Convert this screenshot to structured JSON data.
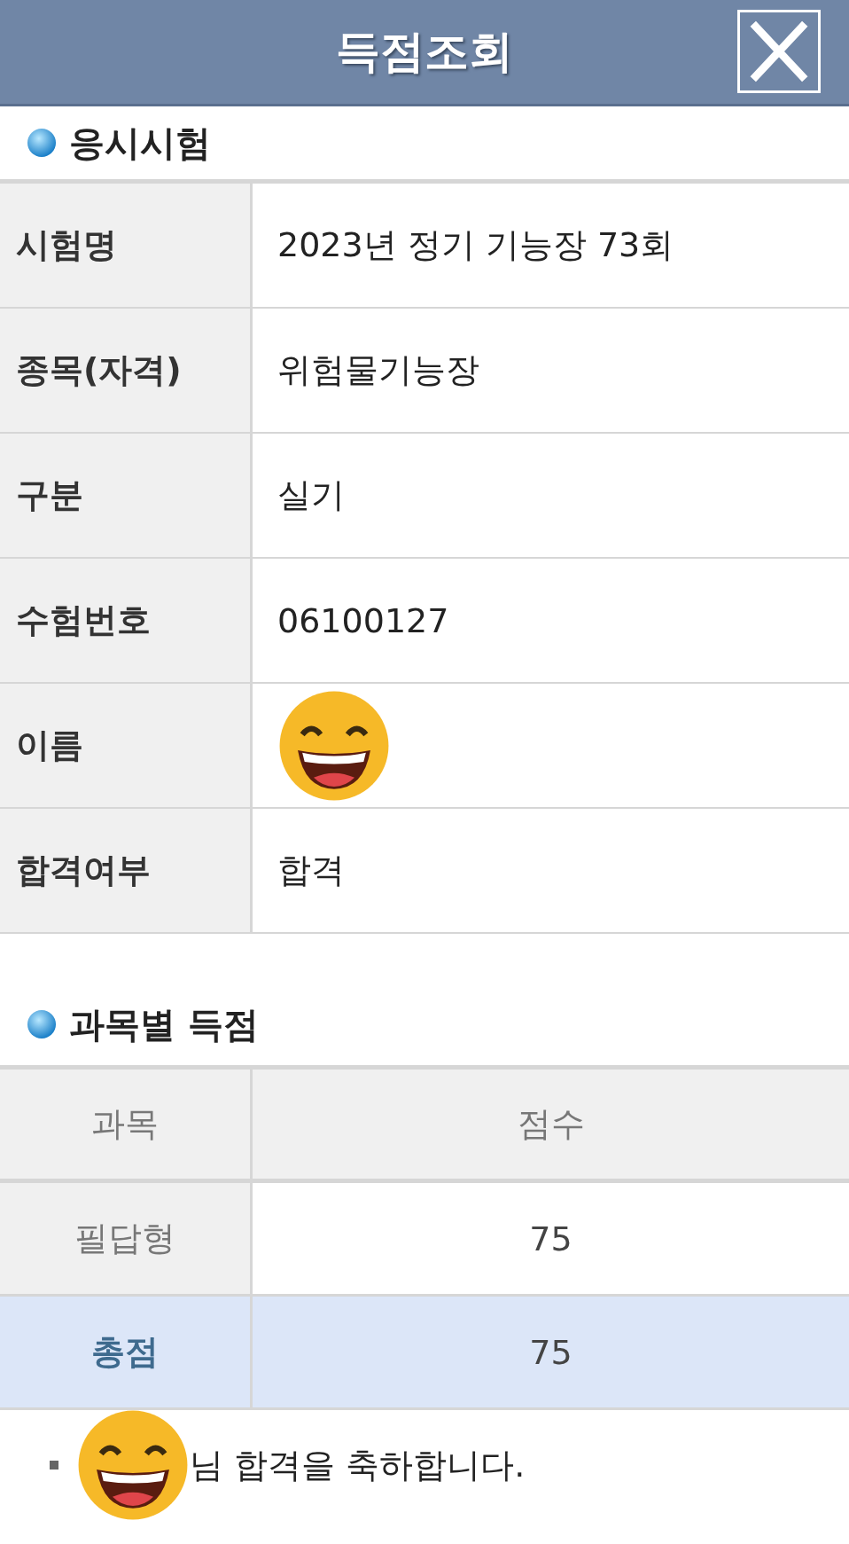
{
  "header": {
    "title": "득점조회"
  },
  "exam": {
    "heading": "응시시험",
    "rows": [
      {
        "label": "시험명",
        "kind": "text",
        "value": "2023년 정기 기능장 73회"
      },
      {
        "label": "종목(자격)",
        "kind": "text",
        "value": "위험물기능장"
      },
      {
        "label": "구분",
        "kind": "text",
        "value": "실기"
      },
      {
        "label": "수험번호",
        "kind": "text",
        "value": "06100127"
      },
      {
        "label": "이름",
        "kind": "sticker"
      },
      {
        "label": "합격여부",
        "kind": "text",
        "value": "합격"
      }
    ]
  },
  "scores": {
    "heading": "과목별 득점",
    "columns": [
      "과목",
      "점수"
    ],
    "rows": [
      {
        "subject": "필답형",
        "score": "75",
        "kind": "subject"
      },
      {
        "subject": "총점",
        "score": "75",
        "kind": "total"
      }
    ]
  },
  "message": {
    "text": "님 합격을 축하합니다."
  }
}
